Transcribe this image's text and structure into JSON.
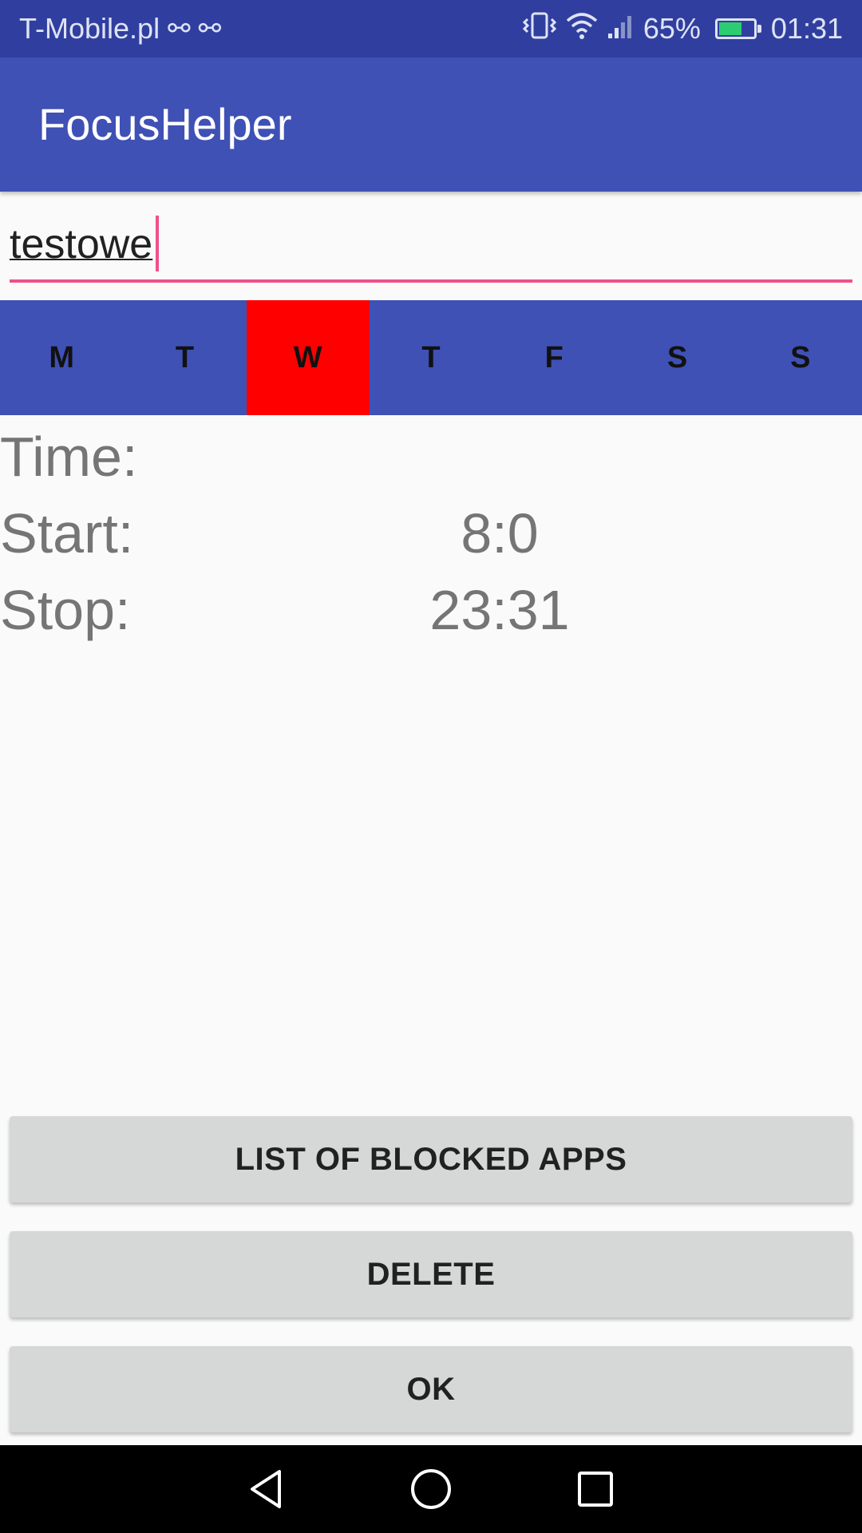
{
  "status_bar": {
    "carrier": "T-Mobile.pl",
    "usb_icons": [
      "usb-icon",
      "usb-icon"
    ],
    "battery_percent": "65%",
    "time": "01:31"
  },
  "app_bar": {
    "title": "FocusHelper"
  },
  "name_input": {
    "value": "testowe"
  },
  "days": {
    "items": [
      "M",
      "T",
      "W",
      "T",
      "F",
      "S",
      "S"
    ],
    "selected_index": 2,
    "selected_color": "#ff0000",
    "bar_color": "#3f51b5"
  },
  "time": {
    "time_label": "Time:",
    "start_label": "Start:",
    "start_value": "8:0",
    "stop_label": "Stop:",
    "stop_value": "23:31"
  },
  "buttons": {
    "blocked_apps": "LIST OF BLOCKED APPS",
    "delete": "DELETE",
    "ok": "OK"
  },
  "colors": {
    "primary": "#3f51b5",
    "primary_dark": "#303f9f",
    "accent": "#f0508a"
  }
}
